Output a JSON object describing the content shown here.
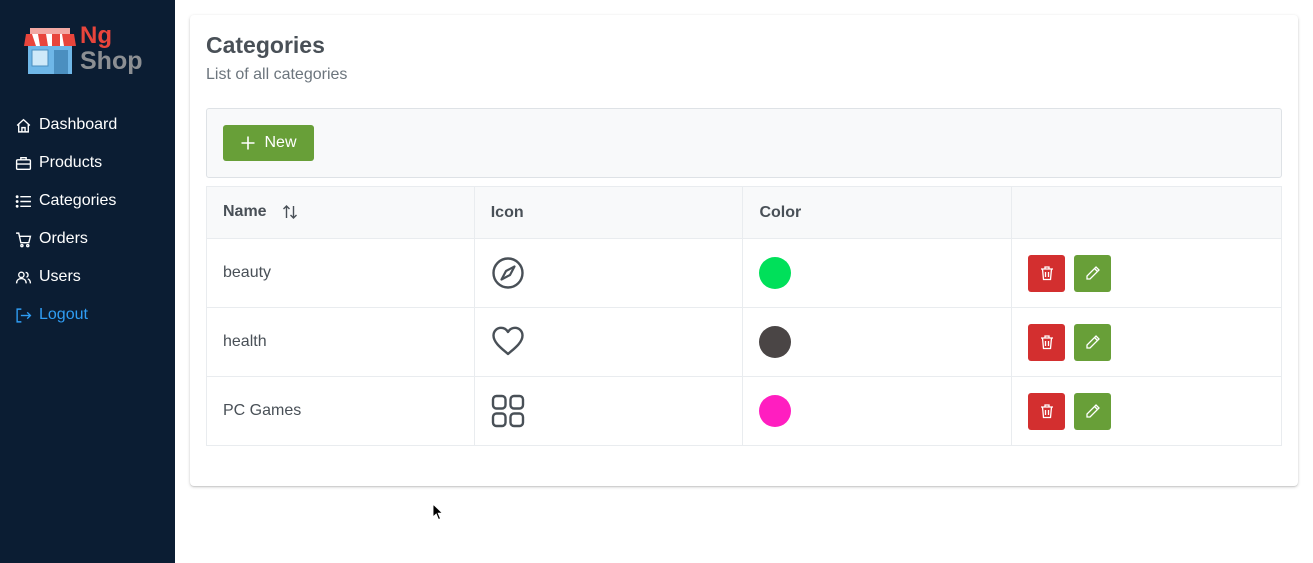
{
  "brand": {
    "logo_name": "store-logo",
    "line1": "Ng",
    "line2": "Shop",
    "colors": {
      "ng": "#e8453c",
      "shop": "#8c8f93"
    }
  },
  "sidebar": {
    "items": [
      {
        "label": "Dashboard",
        "icon": "home-icon"
      },
      {
        "label": "Products",
        "icon": "briefcase-icon"
      },
      {
        "label": "Categories",
        "icon": "list-icon"
      },
      {
        "label": "Orders",
        "icon": "cart-icon"
      },
      {
        "label": "Users",
        "icon": "users-icon"
      },
      {
        "label": "Logout",
        "icon": "sign-out-icon"
      }
    ]
  },
  "page": {
    "title": "Categories",
    "subtitle": "List of all categories"
  },
  "toolbar": {
    "new_label": "New"
  },
  "table": {
    "columns": [
      "Name",
      "Icon",
      "Color",
      ""
    ],
    "rows": [
      {
        "name": "beauty",
        "icon": "compass-icon",
        "color": "#00e05a"
      },
      {
        "name": "health",
        "icon": "heart-icon",
        "color": "#4a4545"
      },
      {
        "name": "PC Games",
        "icon": "th-large-icon",
        "color": "#ff1ec0"
      }
    ]
  },
  "colors": {
    "sidebar_bg": "#0b1d33",
    "accent_green": "#689f38",
    "danger_red": "#d32f2f",
    "logout_blue": "#2f9df4"
  }
}
